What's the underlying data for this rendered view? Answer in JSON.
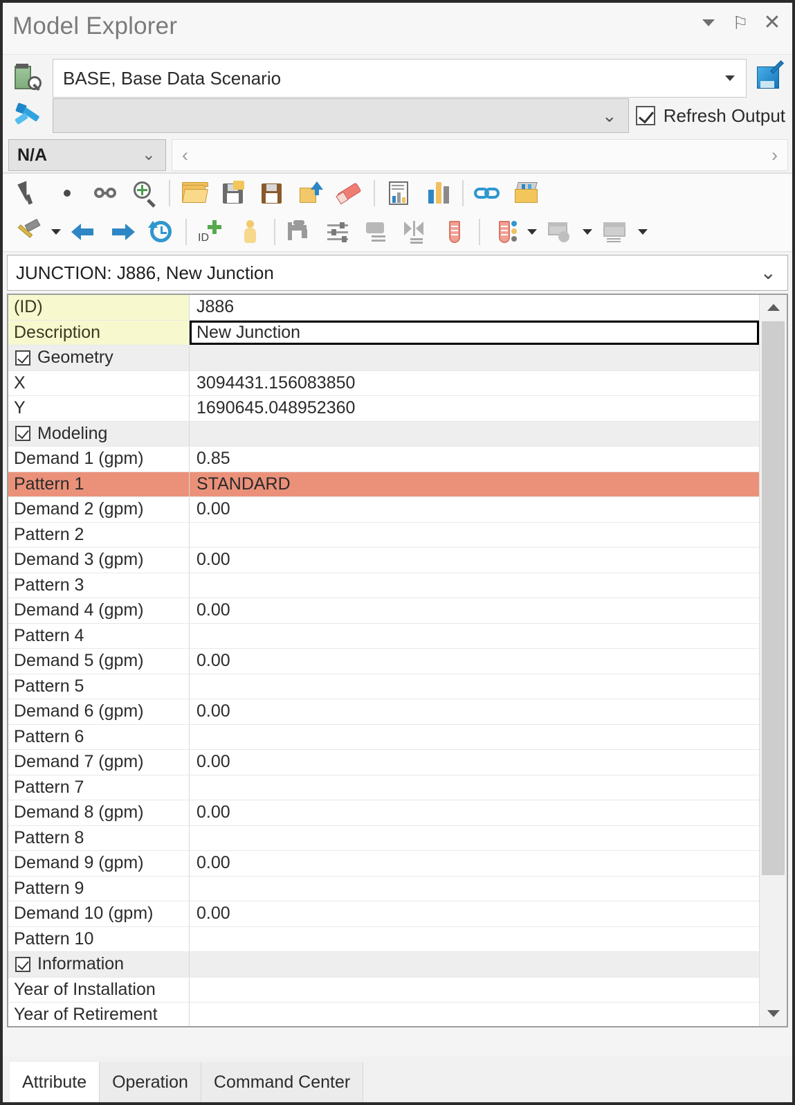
{
  "window": {
    "title": "Model Explorer",
    "buttons": [
      {
        "name": "menu-dropdown",
        "icon": "caret-down-icon"
      },
      {
        "name": "pin",
        "icon": "pin-icon",
        "glyph": "⚐"
      },
      {
        "name": "close",
        "icon": "close-icon",
        "glyph": "✕"
      }
    ]
  },
  "scenario": {
    "icon": "scenario-icon",
    "value": "BASE, Base Data Scenario",
    "edit_icon": "edit-scenario-icon"
  },
  "filter": {
    "icon": "flyout-icon",
    "value": "",
    "placeholder": "",
    "refresh_output_label": "Refresh Output",
    "refresh_output_checked": true
  },
  "navrow": {
    "selector_value": "N/A",
    "prev_glyph": "‹",
    "next_glyph": "›"
  },
  "toolbar_row1": [
    {
      "name": "select-arrow-icon",
      "kind": "arrow"
    },
    {
      "name": "point-dot-icon",
      "kind": "dot"
    },
    {
      "name": "glasses-icon",
      "kind": "glasses"
    },
    {
      "name": "zoom-to-icon",
      "kind": "zoom"
    },
    {
      "name": "separator",
      "kind": "sep"
    },
    {
      "name": "open-folder-icon",
      "kind": "folder"
    },
    {
      "name": "save-as-icon",
      "kind": "save-as"
    },
    {
      "name": "save-icon",
      "kind": "save-brown"
    },
    {
      "name": "restore-icon",
      "kind": "open-up"
    },
    {
      "name": "eraser-icon",
      "kind": "eraser"
    },
    {
      "name": "separator",
      "kind": "sep"
    },
    {
      "name": "report-icon",
      "kind": "report"
    },
    {
      "name": "bar-chart-icon",
      "kind": "bars"
    },
    {
      "name": "separator",
      "kind": "sep"
    },
    {
      "name": "link-icon",
      "kind": "link"
    },
    {
      "name": "briefcase-icon",
      "kind": "case"
    }
  ],
  "toolbar_row2": [
    {
      "name": "hammer-icon",
      "kind": "hammer"
    },
    {
      "name": "hammer-dropdown",
      "kind": "drop"
    },
    {
      "name": "back-arrow-icon",
      "kind": "left-arrow"
    },
    {
      "name": "forward-arrow-icon",
      "kind": "right-arrow"
    },
    {
      "name": "history-icon",
      "kind": "history"
    },
    {
      "name": "separator",
      "kind": "sep"
    },
    {
      "name": "add-id-icon",
      "kind": "idplus"
    },
    {
      "name": "person-icon",
      "kind": "person"
    },
    {
      "name": "separator",
      "kind": "sep"
    },
    {
      "name": "tap-icon",
      "kind": "tap"
    },
    {
      "name": "sliders-icon",
      "kind": "sliders"
    },
    {
      "name": "group-icon",
      "kind": "group"
    },
    {
      "name": "split-icon",
      "kind": "split"
    },
    {
      "name": "flask-icon",
      "kind": "flask"
    },
    {
      "name": "separator",
      "kind": "sep"
    },
    {
      "name": "flask-scenario-icon",
      "kind": "flaskdots"
    },
    {
      "name": "flask-dropdown",
      "kind": "drop"
    },
    {
      "name": "report-window-icon",
      "kind": "gray-rep"
    },
    {
      "name": "report-window-dropdown",
      "kind": "drop"
    },
    {
      "name": "table-window-icon",
      "kind": "gray-tbl"
    },
    {
      "name": "table-window-dropdown",
      "kind": "drop"
    }
  ],
  "element_selector": {
    "value": "JUNCTION: J886, New Junction"
  },
  "properties": [
    {
      "name": "(ID)",
      "value": "J886",
      "style": "key"
    },
    {
      "name": "Description",
      "value": "New Junction",
      "style": "key editing"
    },
    {
      "name": "Geometry",
      "value": "",
      "style": "cat"
    },
    {
      "name": "X",
      "value": "3094431.156083850",
      "style": ""
    },
    {
      "name": "Y",
      "value": "1690645.048952360",
      "style": ""
    },
    {
      "name": "Modeling",
      "value": "",
      "style": "cat"
    },
    {
      "name": "Demand 1 (gpm)",
      "value": "0.85",
      "style": ""
    },
    {
      "name": "Pattern 1",
      "value": "STANDARD",
      "style": "hl"
    },
    {
      "name": "Demand 2 (gpm)",
      "value": "0.00",
      "style": ""
    },
    {
      "name": "Pattern 2",
      "value": "",
      "style": ""
    },
    {
      "name": "Demand 3 (gpm)",
      "value": "0.00",
      "style": ""
    },
    {
      "name": "Pattern 3",
      "value": "",
      "style": ""
    },
    {
      "name": "Demand 4 (gpm)",
      "value": "0.00",
      "style": ""
    },
    {
      "name": "Pattern 4",
      "value": "",
      "style": ""
    },
    {
      "name": "Demand 5 (gpm)",
      "value": "0.00",
      "style": ""
    },
    {
      "name": "Pattern 5",
      "value": "",
      "style": ""
    },
    {
      "name": "Demand 6 (gpm)",
      "value": "0.00",
      "style": ""
    },
    {
      "name": "Pattern 6",
      "value": "",
      "style": ""
    },
    {
      "name": "Demand 7 (gpm)",
      "value": "0.00",
      "style": ""
    },
    {
      "name": "Pattern 7",
      "value": "",
      "style": ""
    },
    {
      "name": "Demand 8 (gpm)",
      "value": "0.00",
      "style": ""
    },
    {
      "name": "Pattern 8",
      "value": "",
      "style": ""
    },
    {
      "name": "Demand 9 (gpm)",
      "value": "0.00",
      "style": ""
    },
    {
      "name": "Pattern 9",
      "value": "",
      "style": ""
    },
    {
      "name": "Demand 10 (gpm)",
      "value": "0.00",
      "style": ""
    },
    {
      "name": "Pattern 10",
      "value": "",
      "style": ""
    },
    {
      "name": "Information",
      "value": "",
      "style": "cat"
    },
    {
      "name": "Year of Installation",
      "value": "",
      "style": ""
    },
    {
      "name": "Year of Retirement",
      "value": "",
      "style": ""
    }
  ],
  "scrollbar": {
    "up_glyph": "∧",
    "down_glyph": "∨"
  },
  "tabs": [
    {
      "label": "Attribute",
      "active": true
    },
    {
      "label": "Operation",
      "active": false
    },
    {
      "label": "Command Center",
      "active": false
    }
  ],
  "colors": {
    "highlight_row": "#eb917a",
    "key_cell": "#f8f8cf",
    "category_row": "#eeeeee",
    "accent_blue": "#2f86c4"
  }
}
